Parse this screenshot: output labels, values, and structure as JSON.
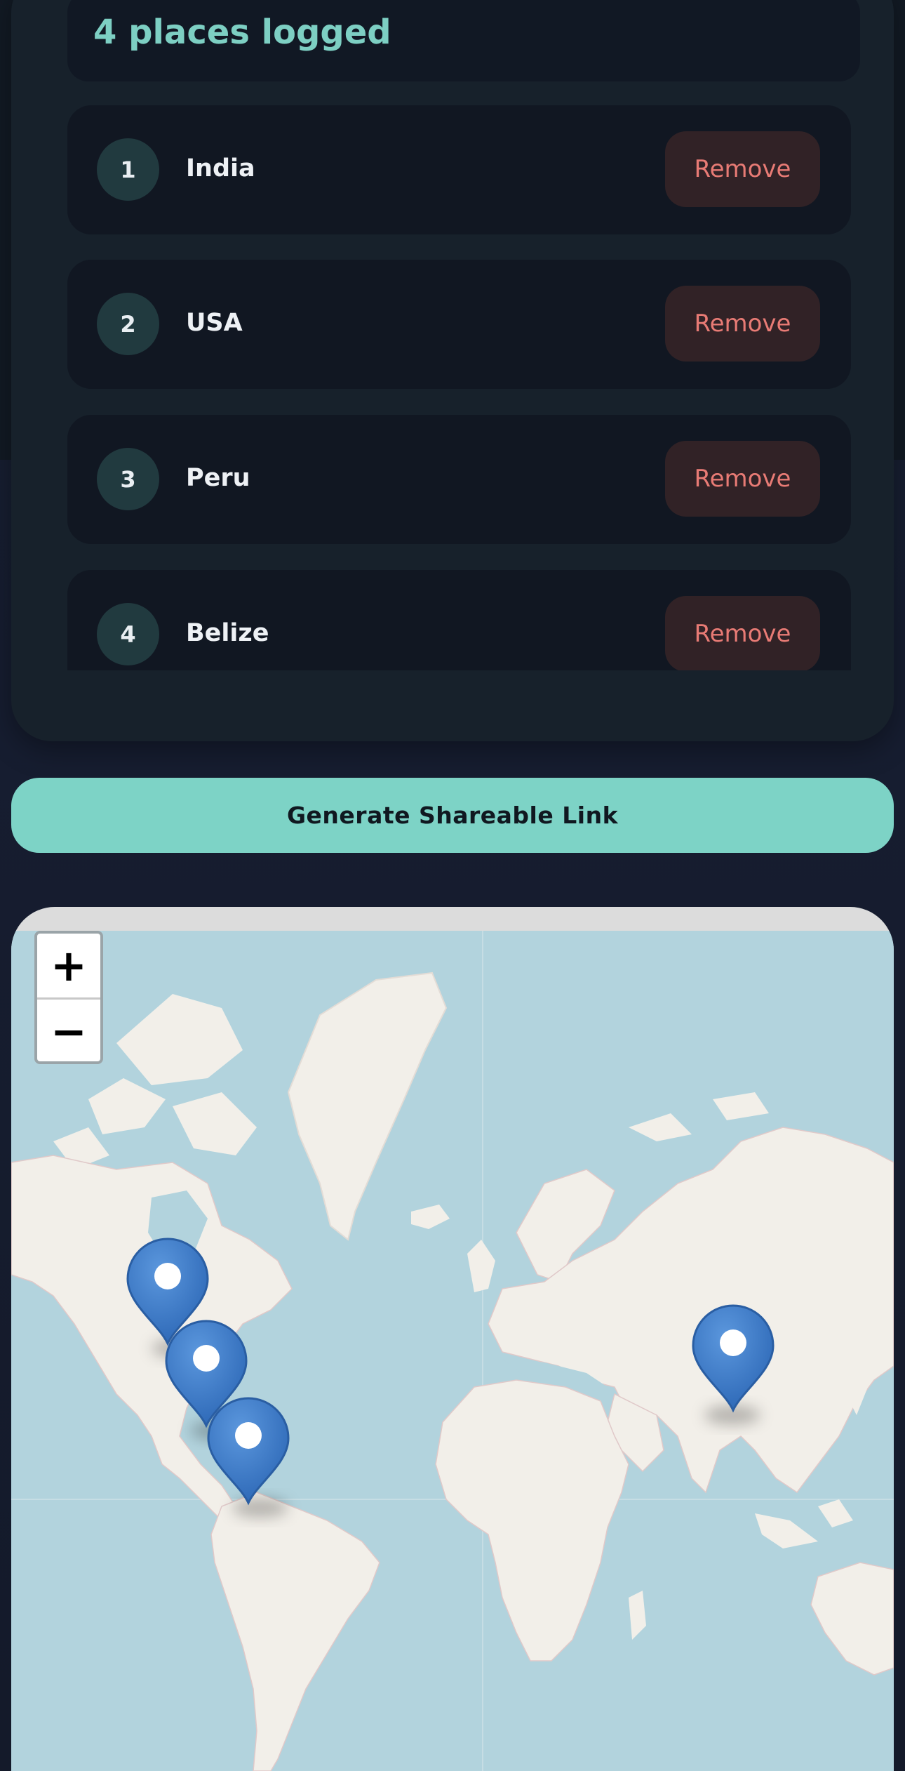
{
  "summary": {
    "count_text": "4 places logged"
  },
  "places": [
    {
      "number": "1",
      "name": "India",
      "remove_label": "Remove"
    },
    {
      "number": "2",
      "name": "USA",
      "remove_label": "Remove"
    },
    {
      "number": "3",
      "name": "Peru",
      "remove_label": "Remove"
    },
    {
      "number": "4",
      "name": "Belize",
      "remove_label": "Remove"
    }
  ],
  "actions": {
    "generate_label": "Generate Shareable Link"
  },
  "map": {
    "zoom_in_label": "+",
    "zoom_out_label": "−",
    "markers": [
      "India",
      "USA",
      "Belize",
      "Peru"
    ],
    "colors": {
      "water": "#b2d3dd",
      "land": "#f2efe9",
      "marker": "#3f7fd0",
      "accent": "#7dd3c6"
    }
  }
}
